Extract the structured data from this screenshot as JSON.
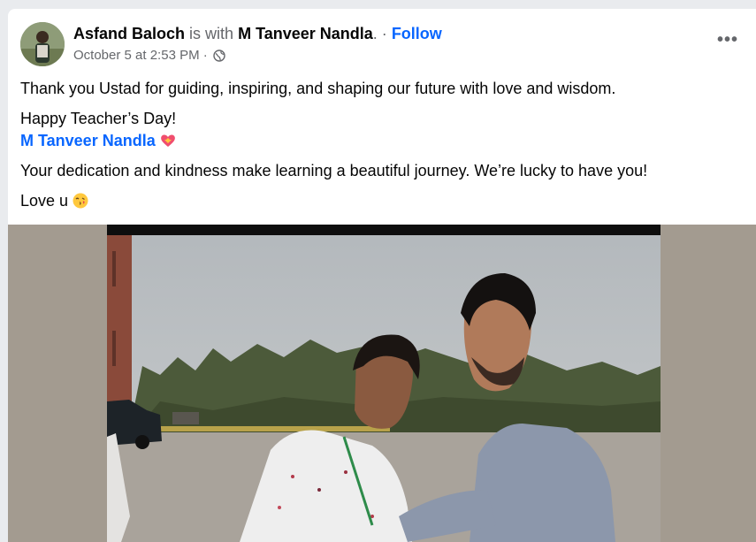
{
  "post": {
    "author": "Asfand Baloch",
    "with_text": "is with",
    "tagged": "M Tanveer Nandla",
    "separator": ". ·",
    "follow_label": "Follow",
    "timestamp": "October 5 at 2:53 PM",
    "timestamp_sep": "·",
    "privacy_icon": "globe-icon",
    "more_label": "•••",
    "lines": {
      "l1": "Thank you Ustad for guiding, inspiring, and shaping our future with love and wisdom.",
      "l2": "Happy Teacher’s Day!",
      "mention": "M Tanveer Nandla",
      "l4": "Your dedication and kindness make learning a beautiful journey. We’re lucky to have you!",
      "l5": "Love u"
    },
    "emojis": [
      "heart-with-ribbon-icon",
      "face-blowing-kiss-icon"
    ]
  },
  "colors": {
    "link": "#0866ff",
    "muted": "#65676b",
    "text": "#050505"
  }
}
